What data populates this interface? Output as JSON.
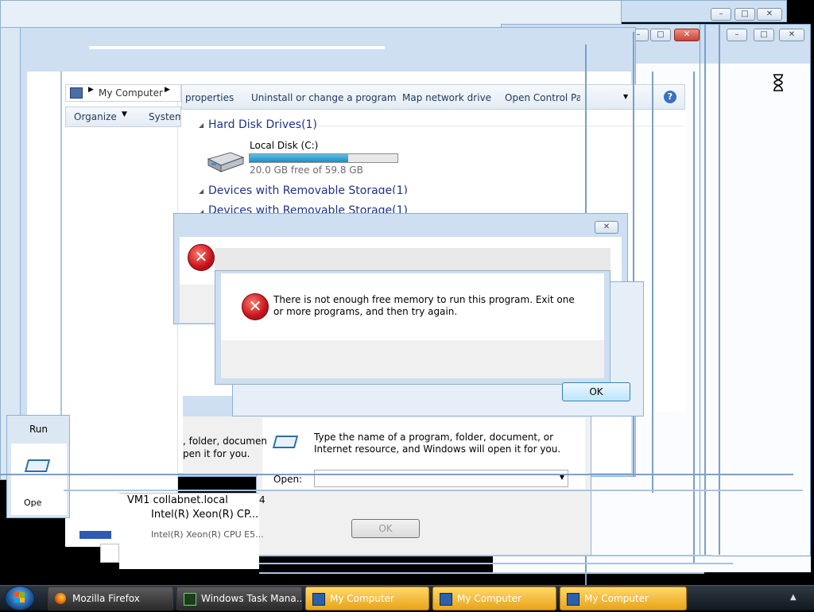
{
  "explorer": {
    "breadcrumb": "My Computer",
    "toolbar": {
      "organize": "Organize",
      "system": "System",
      "properties": "properties",
      "uninstall": "Uninstall or change a program",
      "map_drive": "Map network drive",
      "control_panel": "Open Control Pan"
    },
    "hard_disk_header": "Hard Disk Drives(1)",
    "disk_name": "Local Disk (C:)",
    "disk_free": "20.0 GB free of 59.8 GB",
    "disk_used_fraction": 0.665,
    "removable_header": "Devices with Removable Storage(1)",
    "removable_header_dup": "Devices with Removable Storage(1)"
  },
  "error_dialog": {
    "message": "There is not enough free memory to run this program. Exit one or more programs, and then try again.",
    "ok_label": "OK",
    "close_glyph": "✕"
  },
  "run_dialog": {
    "title": "Run",
    "description": "Type the name of a program, folder, document, or Internet resource, and Windows will open it for you.",
    "open_label": "Open:",
    "ok_label": "OK",
    "frag_description": ", folder, documen",
    "frag_description2": "pen it for you.",
    "frag_open": "Ope"
  },
  "task_manager_fragment": {
    "host": "VM1 collabnet.local",
    "cpu1": "Intel(R) Xeon(R) CP...",
    "cpu2": "Intel(R) Xeon(R) CPU E5...",
    "num": "4"
  },
  "taskbar": {
    "items": [
      {
        "label": "Mozilla Firefox"
      },
      {
        "label": "Windows Task Mana..."
      },
      {
        "label": "My Computer"
      },
      {
        "label": "My Computer"
      },
      {
        "label": "My Computer"
      }
    ]
  },
  "colors": {
    "accent": "#cddff0",
    "error_red": "#c5121a",
    "taskbar_active": "#e8a418",
    "disk_bar": "#2b9bd0"
  }
}
